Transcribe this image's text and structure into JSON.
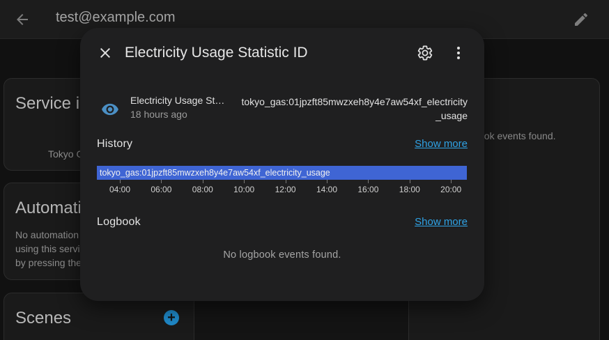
{
  "topbar": {
    "title": "test@example.com"
  },
  "background": {
    "service_card": {
      "title": "Service in",
      "subtitle": "Tokyo G"
    },
    "automation_card": {
      "title": "Automati",
      "lines": [
        "No automation",
        "using this servi",
        "by pressing the"
      ]
    },
    "scenes_card": {
      "title": "Scenes"
    },
    "logbook_partial": "ook events found."
  },
  "dialog": {
    "title": "Electricity Usage Statistic ID",
    "entity": {
      "name": "Electricity Usage St…",
      "time": "18 hours ago",
      "state": "tokyo_gas:01jpzft85mwzxeh8y4e7aw54xf_electricity_usage"
    },
    "history": {
      "title": "History",
      "show_more": "Show more",
      "bar_label": "tokyo_gas:01jpzft85mwzxeh8y4e7aw54xf_electricity_usage",
      "ticks": [
        "04:00",
        "06:00",
        "08:00",
        "10:00",
        "12:00",
        "14:00",
        "16:00",
        "18:00",
        "20:00"
      ]
    },
    "logbook": {
      "title": "Logbook",
      "show_more": "Show more",
      "empty": "No logbook events found."
    }
  },
  "colors": {
    "accent": "#2fa3e6",
    "timeline_bar": "#3f65d4",
    "eye_icon": "#4b8fc4"
  }
}
